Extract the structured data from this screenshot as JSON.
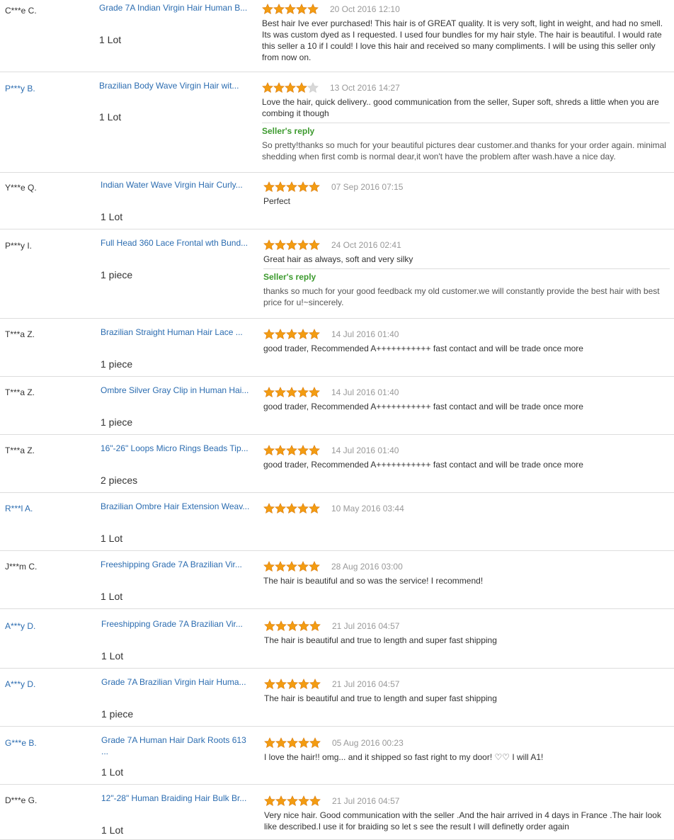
{
  "colors": {
    "link": "#2b6cb0",
    "star_on": "#f39c12",
    "star_off": "#d8d8d8",
    "reply_label": "#3c9a2e",
    "date": "#999999"
  },
  "icons": {
    "star": "star-icon"
  },
  "reply_label": "Seller's reply",
  "feedbacks": [
    {
      "buyer": "C***e C.",
      "product": "Grade 7A Indian Virgin Hair Human B...",
      "qty": "1 Lot",
      "stars": 5,
      "date": "20 Oct 2016 12:10",
      "comment": "Best hair Ive ever purchased! This hair is of GREAT quality. It is very soft, light in weight, and had no smell. Its was custom dyed as I requested. I used four bundles for my hair style. The hair is beautiful. I would rate this seller a 10 if I could! I love this hair and received so many compliments. I will be using this seller only from now on.",
      "reply": ""
    },
    {
      "buyer": "P***y B.",
      "product": "Brazilian Body Wave Virgin Hair wit...",
      "qty": "1 Lot",
      "stars": 4,
      "date": "13 Oct 2016 14:27",
      "comment": "Love the hair, quick delivery.. good communication from the seller, Super soft, shreds a little when you are combing it though",
      "reply": "So pretty!thanks so much for your beautiful pictures dear customer.and thanks for your order again. minimal shedding when first comb is normal dear,it won't have the problem after wash.have a nice day."
    },
    {
      "buyer": "Y***e Q.",
      "product": "Indian Water Wave Virgin Hair Curly...",
      "qty": "1 Lot",
      "stars": 5,
      "date": "07 Sep 2016 07:15",
      "comment": "Perfect",
      "reply": ""
    },
    {
      "buyer": "P***y I.",
      "product": "Full Head 360 Lace Frontal wth Bund...",
      "qty": "1 piece",
      "stars": 5,
      "date": "24 Oct 2016 02:41",
      "comment": "Great hair as always, soft and very silky",
      "reply": "thanks so much for your good feedback my old customer.we will constantly provide the best hair with best price for u!~sincerely."
    },
    {
      "buyer": "T***a Z.",
      "product": "Brazilian Straight Human Hair Lace ...",
      "qty": "1 piece",
      "stars": 5,
      "date": "14 Jul 2016 01:40",
      "comment": "good trader, Recommended A+++++++++++ fast contact and will be trade once more",
      "reply": ""
    },
    {
      "buyer": "T***a Z.",
      "product": "Ombre Silver Gray Clip in Human Hai...",
      "qty": "1 piece",
      "stars": 5,
      "date": "14 Jul 2016 01:40",
      "comment": "good trader, Recommended A+++++++++++ fast contact and will be trade once more",
      "reply": ""
    },
    {
      "buyer": "T***a Z.",
      "product": "16\"-26\" Loops Micro Rings Beads Tip...",
      "qty": "2 pieces",
      "stars": 5,
      "date": "14 Jul 2016 01:40",
      "comment": "good trader, Recommended A+++++++++++ fast contact and will be trade once more",
      "reply": ""
    },
    {
      "buyer": "R***l A.",
      "product": "Brazilian Ombre Hair Extension Weav...",
      "qty": "1 Lot",
      "stars": 5,
      "date": "10 May 2016 03:44",
      "comment": "",
      "reply": ""
    },
    {
      "buyer": "J***m C.",
      "product": "Freeshipping Grade 7A Brazilian Vir...",
      "qty": "1 Lot",
      "stars": 5,
      "date": "28 Aug 2016 03:00",
      "comment": "The hair is beautiful and so was the service! I recommend!",
      "reply": ""
    },
    {
      "buyer": "A***y D.",
      "product": "Freeshipping Grade 7A Brazilian Vir...",
      "qty": "1 Lot",
      "stars": 5,
      "date": "21 Jul 2016 04:57",
      "comment": "The hair is beautiful and true to length and super fast shipping",
      "reply": ""
    },
    {
      "buyer": "A***y D.",
      "product": "Grade 7A Brazilian Virgin Hair Huma...",
      "qty": "1 piece",
      "stars": 5,
      "date": "21 Jul 2016 04:57",
      "comment": "The hair is beautiful and true to length and super fast shipping",
      "reply": ""
    },
    {
      "buyer": "G***e B.",
      "product": "Grade 7A Human Hair Dark Roots 613 ...",
      "qty": "1 Lot",
      "stars": 5,
      "date": "05 Aug 2016 00:23",
      "comment": "I love the hair!! omg... and it shipped so fast right to my door! ♡♡ I will A1!",
      "reply": ""
    },
    {
      "buyer": "D***e G.",
      "product": "12\"-28\" Human Braiding Hair Bulk Br...",
      "qty": "1 Lot",
      "stars": 5,
      "date": "21 Jul 2016 04:57",
      "comment": "Very nice hair. Good communication with the seller .And the hair arrived in 4 days in France .The hair look like described.I use it for braiding so let s see the result I will definetly order again",
      "reply": ""
    }
  ]
}
